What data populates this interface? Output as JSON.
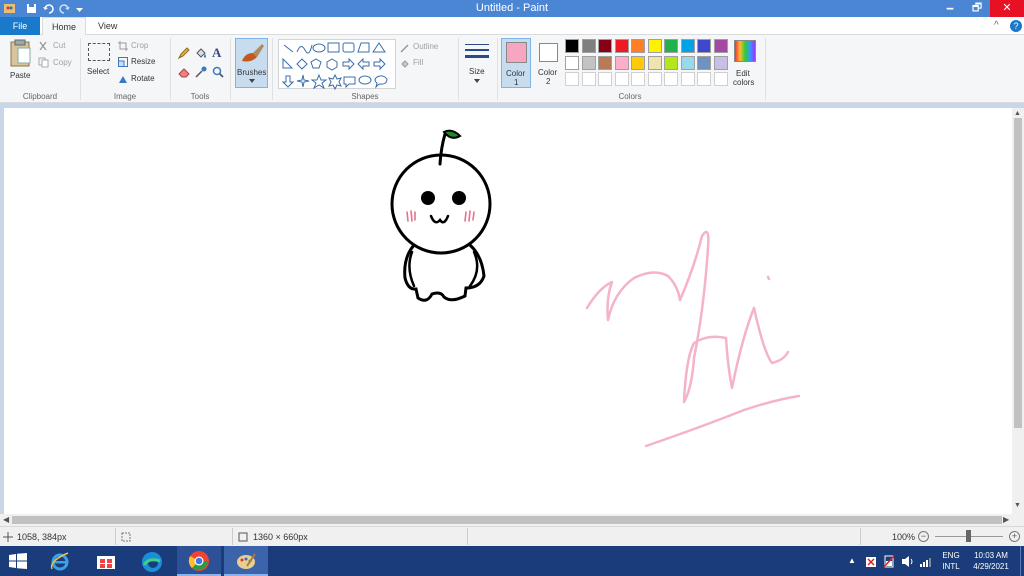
{
  "window": {
    "title": "Untitled - Paint",
    "minimize": "🗕",
    "restore": "🗗",
    "close": "✕"
  },
  "tabs": {
    "file": "File",
    "home": "Home",
    "view": "View"
  },
  "help": {
    "chevron": "^",
    "question": "?"
  },
  "ribbon": {
    "clipboard": {
      "label": "Clipboard",
      "paste": "Paste",
      "cut": "Cut",
      "copy": "Copy"
    },
    "image": {
      "label": "Image",
      "select": "Select",
      "crop": "Crop",
      "resize": "Resize",
      "rotate": "Rotate"
    },
    "tools": {
      "label": "Tools"
    },
    "brushes": {
      "label": "Brushes"
    },
    "shapes": {
      "label": "Shapes",
      "outline": "Outline",
      "fill": "Fill"
    },
    "size": {
      "label": "Size"
    },
    "colors": {
      "label": "Colors",
      "color1": "Color",
      "color1_num": "1",
      "color2": "Color",
      "color2_num": "2",
      "edit1": "Edit",
      "edit2": "colors",
      "color1_value": "#f7a6c2",
      "color2_value": "#ffffff",
      "palette_row1": [
        "#000000",
        "#7f7f7f",
        "#880015",
        "#ed1c24",
        "#ff7f27",
        "#fff200",
        "#22b14c",
        "#00a2e8",
        "#3f48cc",
        "#a349a4"
      ],
      "palette_row2": [
        "#ffffff",
        "#c3c3c3",
        "#b97a57",
        "#ffaec9",
        "#ffc90e",
        "#efe4b0",
        "#b5e61d",
        "#99d9ea",
        "#7092be",
        "#c8bfe7"
      ],
      "palette_row3": [
        "#ffffff",
        "#ffffff",
        "#ffffff",
        "#ffffff",
        "#ffffff",
        "#ffffff",
        "#ffffff",
        "#ffffff",
        "#ffffff",
        "#ffffff"
      ]
    }
  },
  "status": {
    "cursor_pos": "1058, 384px",
    "canvas_size": "1360 × 660px",
    "zoom": "100%"
  },
  "taskbar": {
    "lang1": "ENG",
    "lang2": "INTL",
    "time": "10:03 AM",
    "date": "4/29/2021"
  },
  "drawing": {
    "ink_color": "#f4b3c8",
    "outline_color": "#000000",
    "leaf_color": "#1f8a2c"
  }
}
